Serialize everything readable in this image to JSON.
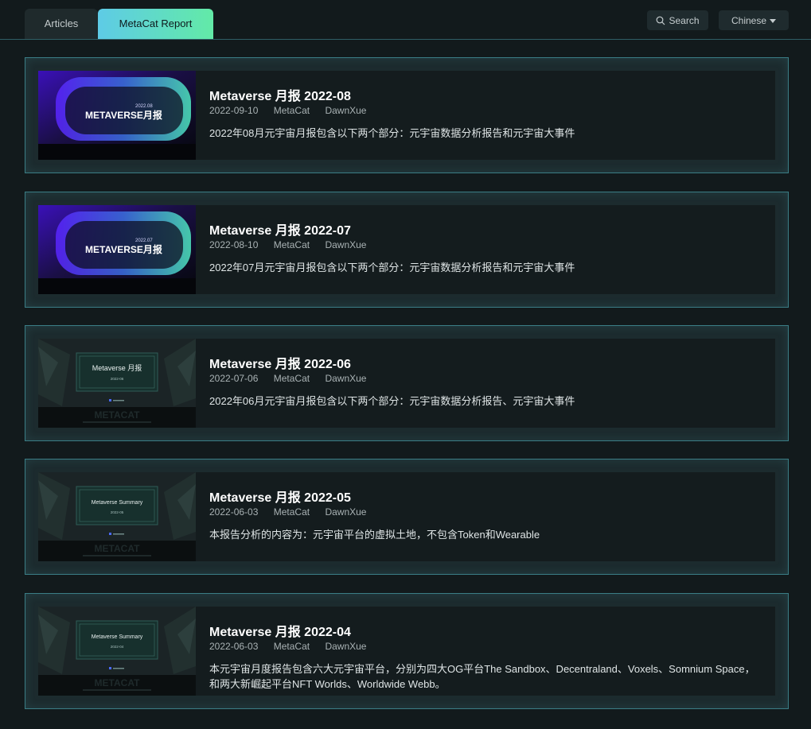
{
  "tabs": [
    {
      "label": "Articles",
      "active": false
    },
    {
      "label": "MetaCat Report",
      "active": true
    }
  ],
  "search_label": "Search",
  "language_label": "Chinese",
  "colors": {
    "accent_start": "#5ecbe6",
    "accent_end": "#62eaa7",
    "card_border": "#3a7d85"
  },
  "reports": [
    {
      "title": "Metaverse 月报 2022-08",
      "date": "2022-09-10",
      "source": "MetaCat",
      "author": "DawnXue",
      "description": "2022年08月元宇宙月报包含以下两个部分：元宇宙数据分析报告和元宇宙大事件",
      "thumb": {
        "style": "gradient",
        "main": "METAVERSE月报",
        "tag": "2022.08"
      }
    },
    {
      "title": "Metaverse 月报 2022-07",
      "date": "2022-08-10",
      "source": "MetaCat",
      "author": "DawnXue",
      "description": "2022年07月元宇宙月报包含以下两个部分：元宇宙数据分析报告和元宇宙大事件",
      "thumb": {
        "style": "gradient",
        "main": "METAVERSE月报",
        "tag": "2022.07"
      }
    },
    {
      "title": "Metaverse 月报 2022-06",
      "date": "2022-07-06",
      "source": "MetaCat",
      "author": "DawnXue",
      "description": "2022年06月元宇宙月报包含以下两个部分：元宇宙数据分析报告、元宇宙大事件",
      "thumb": {
        "style": "dark",
        "main": "Metaverse 月报",
        "tag": "2022-06",
        "brand": "METACAT"
      }
    },
    {
      "title": "Metaverse 月报 2022-05",
      "date": "2022-06-03",
      "source": "MetaCat",
      "author": "DawnXue",
      "description": "本报告分析的内容为：元宇宙平台的虚拟土地，不包含Token和Wearable",
      "thumb": {
        "style": "dark",
        "main": "Metaverse Summary",
        "tag": "2022-05",
        "brand": "METACAT"
      }
    },
    {
      "title": "Metaverse 月报 2022-04",
      "date": "2022-06-03",
      "source": "MetaCat",
      "author": "DawnXue",
      "description": "本元宇宙月度报告包含六大元宇宙平台，分别为四大OG平台The Sandbox、Decentraland、Voxels、Somnium Space，和两大新崛起平台NFT Worlds、Worldwide Webb。",
      "thumb": {
        "style": "dark",
        "main": "Metaverse Summary",
        "tag": "2022-04",
        "brand": "METACAT"
      }
    }
  ]
}
